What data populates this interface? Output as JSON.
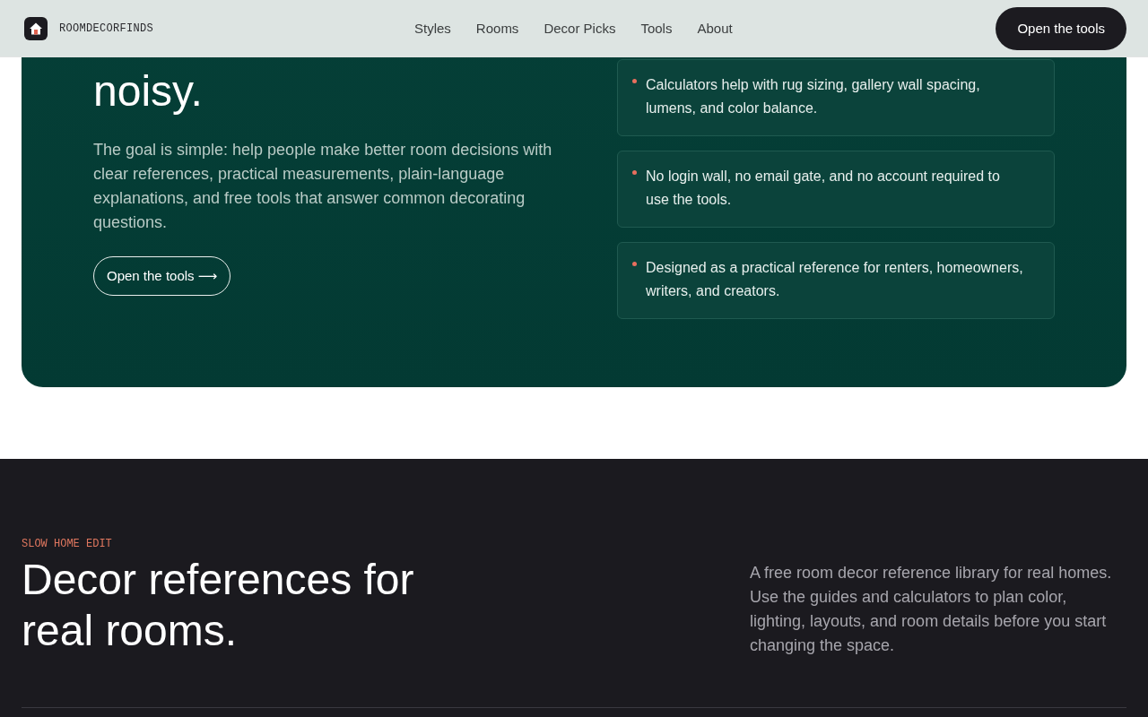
{
  "header": {
    "brand": "ROOMDECORFINDS",
    "nav": [
      {
        "label": "Styles"
      },
      {
        "label": "Rooms"
      },
      {
        "label": "Decor Picks"
      },
      {
        "label": "Tools"
      },
      {
        "label": "About"
      }
    ],
    "cta": "Open the tools"
  },
  "hero": {
    "heading_visible": "noisy.",
    "body": "The goal is simple: help people make better room decisions with clear references, practical measurements, plain-language explanations, and free tools that answer common decorating questions.",
    "button": "Open the tools ⟶",
    "points": [
      {
        "text": "Calculators help with rug sizing, gallery wall spacing, lumens, and color balance."
      },
      {
        "text": "No login wall, no email gate, and no account required to use the tools."
      },
      {
        "text": "Designed as a practical reference for renters, homeowners, writers, and creators."
      }
    ]
  },
  "footer_intro": {
    "kicker": "SLOW HOME EDIT",
    "heading": "Decor references for real rooms.",
    "body": "A free room decor reference library for real homes. Use the guides and calculators to plan color, lighting, layouts, and room details before you start changing the space."
  }
}
